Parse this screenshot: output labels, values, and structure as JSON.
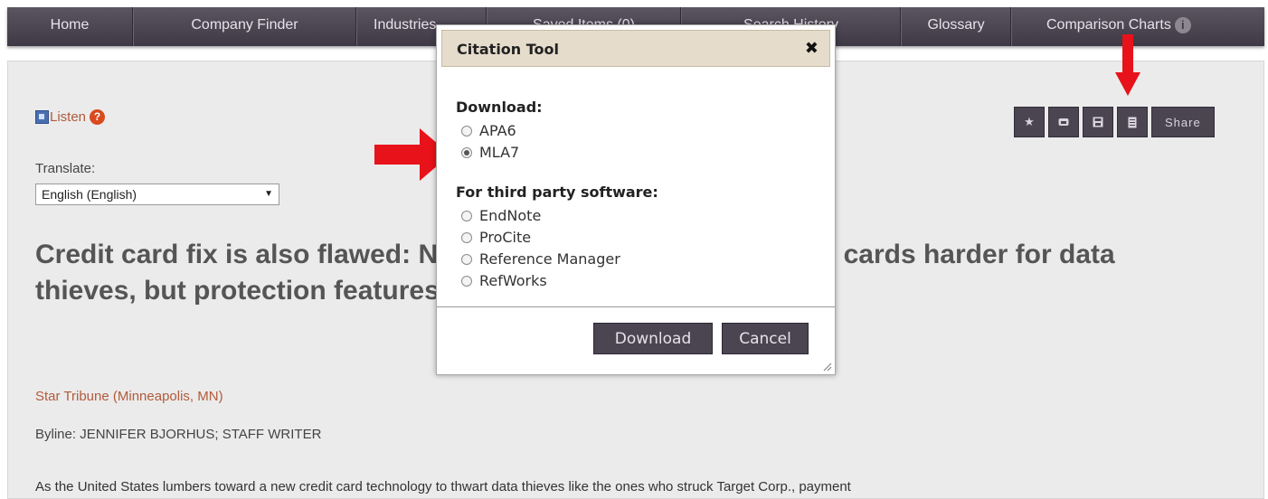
{
  "nav": {
    "items": [
      "Home",
      "Company Finder",
      "Industries",
      "Saved Items (0)",
      "Search History",
      "Glossary",
      "Comparison Charts"
    ]
  },
  "article": {
    "listen_label": "Listen",
    "help_glyph": "?",
    "translate_label": "Translate:",
    "language_selected": "English (English)",
    "title": "Credit card fix is also flawed: New technology will make credit cards harder for data thieves, but protection features have holes",
    "source": "Star Tribune (Minneapolis, MN)",
    "byline": "Byline: JENNIFER BJORHUS; STAFF WRITER",
    "lead": "As the United States lumbers toward a new credit card technology to thwart data thieves like the ones who struck Target Corp., payment"
  },
  "toolbar": {
    "icons": [
      "star-icon",
      "email-icon",
      "save-icon",
      "cite-icon"
    ],
    "share_label": "Share"
  },
  "modal": {
    "title": "Citation Tool",
    "close_glyph": "✖",
    "download_label": "Download:",
    "formats": [
      {
        "label": "APA6",
        "checked": false
      },
      {
        "label": "MLA7",
        "checked": true
      }
    ],
    "third_party_label": "For third party software:",
    "software": [
      {
        "label": "EndNote",
        "checked": false
      },
      {
        "label": "ProCite",
        "checked": false
      },
      {
        "label": "Reference Manager",
        "checked": false
      },
      {
        "label": "RefWorks",
        "checked": false
      }
    ],
    "download_button": "Download",
    "cancel_button": "Cancel"
  },
  "colors": {
    "nav_bg": "#4a4350",
    "accent_link": "#b25a3b",
    "arrow": "#e8121a",
    "button_bg": "#4b4552",
    "modal_header_bg": "#e6dccc"
  }
}
